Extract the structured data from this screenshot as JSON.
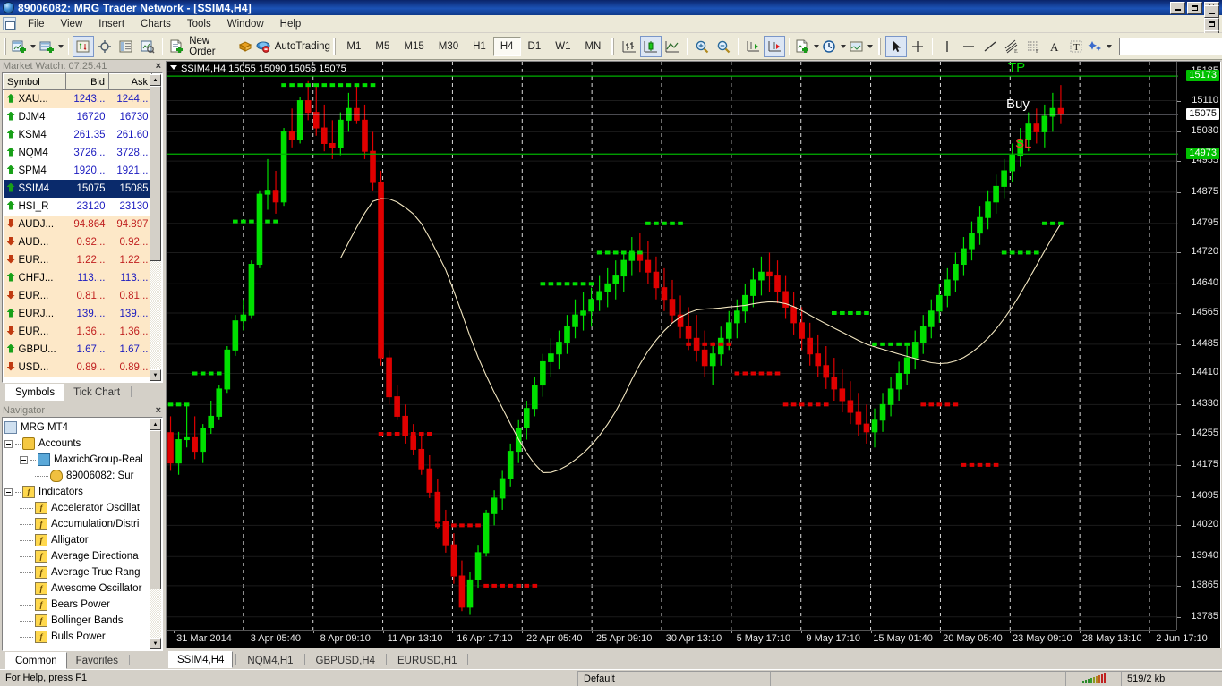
{
  "window": {
    "title": "89006082: MRG Trader Network - [SSIM4,H4]",
    "minimize": "_",
    "restore": "❐",
    "close": "×"
  },
  "menu": {
    "items": [
      "File",
      "View",
      "Insert",
      "Charts",
      "Tools",
      "Window",
      "Help"
    ]
  },
  "toolbar": {
    "new_chart_tip": "New Chart",
    "profiles_tip": "Profiles",
    "market_watch_tip": "Market Watch",
    "navigator_tip": "Navigator",
    "terminal_tip": "Terminal",
    "strategy_tester_tip": "Strategy Tester",
    "new_order": "New Order",
    "expert_advisors_tip": "Expert Advisors",
    "autotrading": "AutoTrading",
    "timeframes": [
      "M1",
      "M5",
      "M15",
      "M30",
      "H1",
      "H4",
      "D1",
      "W1",
      "MN"
    ],
    "timeframe_selected": "H4",
    "bar_chart_tip": "Bar Chart",
    "candlesticks_tip": "Candlesticks",
    "line_chart_tip": "Line Chart",
    "zoom_in_tip": "Zoom In",
    "zoom_out_tip": "Zoom Out",
    "auto_scroll_tip": "Auto Scroll",
    "chart_shift_tip": "Chart Shift",
    "indicators_tip": "Indicators",
    "period_tip": "Period",
    "templates_tip": "Templates",
    "cursor_tip": "Cursor",
    "crosshair_tip": "Crosshair",
    "vertical_line_tip": "Vertical Line",
    "horizontal_line_tip": "Horizontal Line",
    "trendline_tip": "Trendline",
    "equidistant_channel_tip": "Equidistant Channel",
    "fibonacci_tip": "Fibonacci Retracement",
    "text_tip": "Text",
    "text_label_tip": "Text Label",
    "objects_tip": "Objects",
    "search_value": ""
  },
  "market_watch": {
    "title": "Market Watch: 07:25:41",
    "close": "×",
    "columns": [
      "Symbol",
      "Bid",
      "Ask"
    ],
    "rows": [
      {
        "symbol": "XAU...",
        "bid": "1243...",
        "ask": "1244...",
        "dir": "up",
        "tint": true,
        "selected": false
      },
      {
        "symbol": "DJM4",
        "bid": "16720",
        "ask": "16730",
        "dir": "up",
        "tint": false,
        "selected": false
      },
      {
        "symbol": "KSM4",
        "bid": "261.35",
        "ask": "261.60",
        "dir": "up",
        "tint": false,
        "selected": false
      },
      {
        "symbol": "NQM4",
        "bid": "3726...",
        "ask": "3728...",
        "dir": "up",
        "tint": false,
        "selected": false
      },
      {
        "symbol": "SPM4",
        "bid": "1920...",
        "ask": "1921...",
        "dir": "up",
        "tint": false,
        "selected": false
      },
      {
        "symbol": "SSIM4",
        "bid": "15075",
        "ask": "15085",
        "dir": "up",
        "tint": false,
        "selected": true
      },
      {
        "symbol": "HSI_R",
        "bid": "23120",
        "ask": "23130",
        "dir": "up",
        "tint": false,
        "selected": false
      },
      {
        "symbol": "AUDJ...",
        "bid": "94.864",
        "ask": "94.897",
        "dir": "down",
        "tint": true,
        "selected": false
      },
      {
        "symbol": "AUD...",
        "bid": "0.92...",
        "ask": "0.92...",
        "dir": "down",
        "tint": true,
        "selected": false
      },
      {
        "symbol": "EUR...",
        "bid": "1.22...",
        "ask": "1.22...",
        "dir": "down",
        "tint": true,
        "selected": false
      },
      {
        "symbol": "CHFJ...",
        "bid": "113....",
        "ask": "113....",
        "dir": "up",
        "tint": true,
        "selected": false
      },
      {
        "symbol": "EUR...",
        "bid": "0.81...",
        "ask": "0.81...",
        "dir": "down",
        "tint": true,
        "selected": false
      },
      {
        "symbol": "EURJ...",
        "bid": "139....",
        "ask": "139....",
        "dir": "up",
        "tint": true,
        "selected": false
      },
      {
        "symbol": "EUR...",
        "bid": "1.36...",
        "ask": "1.36...",
        "dir": "down",
        "tint": true,
        "selected": false
      },
      {
        "symbol": "GBPU...",
        "bid": "1.67...",
        "ask": "1.67...",
        "dir": "up",
        "tint": true,
        "selected": false
      },
      {
        "symbol": "USD...",
        "bid": "0.89...",
        "ask": "0.89...",
        "dir": "down",
        "tint": true,
        "selected": false
      }
    ],
    "tabs": [
      "Symbols",
      "Tick Chart"
    ],
    "tab_selected": "Symbols"
  },
  "navigator": {
    "title": "Navigator",
    "close": "×",
    "items": [
      {
        "label": "MRG MT4",
        "depth": 0,
        "icon": "app",
        "expander": false
      },
      {
        "label": "Accounts",
        "depth": 0,
        "icon": "acc",
        "expander": true
      },
      {
        "label": "MaxrichGroup-Real",
        "depth": 1,
        "icon": "server",
        "expander": true
      },
      {
        "label": "89006082: Sur",
        "depth": 2,
        "icon": "user",
        "expander": false
      },
      {
        "label": "Indicators",
        "depth": 0,
        "icon": "func",
        "expander": true
      },
      {
        "label": "Accelerator Oscillat",
        "depth": 1,
        "icon": "func",
        "expander": false
      },
      {
        "label": "Accumulation/Distri",
        "depth": 1,
        "icon": "func",
        "expander": false
      },
      {
        "label": "Alligator",
        "depth": 1,
        "icon": "func",
        "expander": false
      },
      {
        "label": "Average Directiona",
        "depth": 1,
        "icon": "func",
        "expander": false
      },
      {
        "label": "Average True Rang",
        "depth": 1,
        "icon": "func",
        "expander": false
      },
      {
        "label": "Awesome Oscillator",
        "depth": 1,
        "icon": "func",
        "expander": false
      },
      {
        "label": "Bears Power",
        "depth": 1,
        "icon": "func",
        "expander": false
      },
      {
        "label": "Bollinger Bands",
        "depth": 1,
        "icon": "func",
        "expander": false
      },
      {
        "label": "Bulls Power",
        "depth": 1,
        "icon": "func",
        "expander": false
      }
    ],
    "tabs": [
      "Common",
      "Favorites"
    ],
    "tab_selected": "Common"
  },
  "chart": {
    "header": "SSIM4,H4  15055 15090 15055 15075",
    "symbol": "SSIM4",
    "period": "H4",
    "ohlc": {
      "open": "15055",
      "high": "15090",
      "low": "15055",
      "close": "15075"
    },
    "labels": {
      "tp": "TP",
      "buy": "Buy",
      "sl": "SL"
    },
    "levels": {
      "tp_price": "15173",
      "buy_price": "15075",
      "sl_price": "14973",
      "tp_color": "#00b000",
      "buy_color": "#c8c8d8",
      "sl_color": "#00b000",
      "tp_tag_bg": "#00c000",
      "sl_tag_bg": "#00c000",
      "buy_tag_bg": "#ffffff"
    },
    "colors": {
      "background": "#000000",
      "bull": "#00e000",
      "bear": "#e00000",
      "moving_average": "#f2e6c0",
      "grid": "#ffffff",
      "axis_text": "#e8e8e8"
    }
  },
  "chart_data": {
    "type": "candlestick",
    "title": "SSIM4,H4",
    "xlabel": "",
    "ylabel": "",
    "ylim": [
      13750,
      15210
    ],
    "y_ticks": [
      15185,
      15110,
      15030,
      14955,
      14875,
      14795,
      14720,
      14640,
      14565,
      14485,
      14410,
      14330,
      14255,
      14175,
      14095,
      14020,
      13940,
      13865,
      13785
    ],
    "x_ticks": [
      "31 Mar 2014",
      "3 Apr 05:40",
      "8 Apr 09:10",
      "11 Apr 13:10",
      "16 Apr 17:10",
      "22 Apr 05:40",
      "25 Apr 09:10",
      "30 Apr 13:10",
      "5 May 17:10",
      "9 May 17:10",
      "15 May 01:40",
      "20 May 05:40",
      "23 May 09:10",
      "28 May 13:10",
      "2 Jun 17:10"
    ],
    "grid": true,
    "legend": false,
    "overlays": [
      {
        "name": "Moving Average",
        "color": "#f2e6c0"
      },
      {
        "name": "Fractals Bands",
        "up_color": "#00e000",
        "down_color": "#e00000"
      }
    ],
    "hlines": [
      {
        "label": "TP",
        "value": 15173,
        "color": "#00b000"
      },
      {
        "label": "Buy",
        "value": 15075,
        "color": "#c8c8d8"
      },
      {
        "label": "SL",
        "value": 14973,
        "color": "#00b000"
      }
    ],
    "candles": [
      [
        14258,
        14300,
        14160,
        14180
      ],
      [
        14180,
        14260,
        14150,
        14240
      ],
      [
        14240,
        14330,
        14220,
        14245
      ],
      [
        14245,
        14300,
        14190,
        14210
      ],
      [
        14210,
        14280,
        14180,
        14270
      ],
      [
        14270,
        14340,
        14255,
        14300
      ],
      [
        14300,
        14380,
        14290,
        14370
      ],
      [
        14370,
        14480,
        14360,
        14470
      ],
      [
        14470,
        14560,
        14455,
        14545
      ],
      [
        14545,
        14600,
        14520,
        14560
      ],
      [
        14560,
        14700,
        14550,
        14690
      ],
      [
        14690,
        14880,
        14680,
        14870
      ],
      [
        14870,
        14960,
        14830,
        14880
      ],
      [
        14880,
        14930,
        14820,
        14850
      ],
      [
        14850,
        15040,
        14840,
        15030
      ],
      [
        15030,
        15090,
        14990,
        15010
      ],
      [
        15010,
        15120,
        15000,
        15110
      ],
      [
        15110,
        15160,
        15060,
        15080
      ],
      [
        15080,
        15150,
        15020,
        15040
      ],
      [
        15040,
        15100,
        14980,
        15000
      ],
      [
        15000,
        15060,
        14960,
        14990
      ],
      [
        14990,
        15080,
        14970,
        15060
      ],
      [
        15060,
        15130,
        15030,
        15090
      ],
      [
        15090,
        15150,
        15050,
        15060
      ],
      [
        15060,
        15100,
        14960,
        14980
      ],
      [
        14980,
        15030,
        14880,
        14900
      ],
      [
        14900,
        14930,
        14430,
        14450
      ],
      [
        14450,
        14470,
        14330,
        14350
      ],
      [
        14350,
        14380,
        14290,
        14300
      ],
      [
        14300,
        14330,
        14230,
        14250
      ],
      [
        14250,
        14280,
        14200,
        14215
      ],
      [
        14215,
        14250,
        14150,
        14165
      ],
      [
        14165,
        14200,
        14090,
        14105
      ],
      [
        14105,
        14140,
        14010,
        14030
      ],
      [
        14030,
        14060,
        13950,
        13970
      ],
      [
        13970,
        14000,
        13870,
        13890
      ],
      [
        13890,
        13930,
        13800,
        13810
      ],
      [
        13810,
        13900,
        13790,
        13880
      ],
      [
        13880,
        13970,
        13860,
        13950
      ],
      [
        13950,
        14060,
        13940,
        14050
      ],
      [
        14050,
        14110,
        14020,
        14090
      ],
      [
        14090,
        14160,
        14060,
        14140
      ],
      [
        14140,
        14230,
        14120,
        14210
      ],
      [
        14210,
        14290,
        14180,
        14270
      ],
      [
        14270,
        14340,
        14240,
        14320
      ],
      [
        14320,
        14400,
        14300,
        14380
      ],
      [
        14380,
        14460,
        14350,
        14440
      ],
      [
        14440,
        14500,
        14400,
        14460
      ],
      [
        14460,
        14520,
        14420,
        14490
      ],
      [
        14490,
        14560,
        14460,
        14530
      ],
      [
        14530,
        14600,
        14500,
        14560
      ],
      [
        14560,
        14620,
        14520,
        14570
      ],
      [
        14570,
        14630,
        14530,
        14600
      ],
      [
        14600,
        14660,
        14570,
        14620
      ],
      [
        14620,
        14680,
        14580,
        14640
      ],
      [
        14640,
        14700,
        14600,
        14660
      ],
      [
        14660,
        14720,
        14620,
        14700
      ],
      [
        14700,
        14760,
        14660,
        14720
      ],
      [
        14720,
        14770,
        14670,
        14700
      ],
      [
        14700,
        14750,
        14640,
        14670
      ],
      [
        14670,
        14710,
        14600,
        14630
      ],
      [
        14630,
        14680,
        14570,
        14600
      ],
      [
        14600,
        14650,
        14540,
        14560
      ],
      [
        14560,
        14610,
        14500,
        14530
      ],
      [
        14530,
        14580,
        14470,
        14500
      ],
      [
        14500,
        14560,
        14440,
        14470
      ],
      [
        14470,
        14520,
        14400,
        14430
      ],
      [
        14430,
        14490,
        14380,
        14460
      ],
      [
        14460,
        14530,
        14430,
        14500
      ],
      [
        14500,
        14570,
        14470,
        14540
      ],
      [
        14540,
        14600,
        14500,
        14570
      ],
      [
        14570,
        14640,
        14540,
        14610
      ],
      [
        14610,
        14680,
        14580,
        14650
      ],
      [
        14650,
        14710,
        14610,
        14670
      ],
      [
        14670,
        14720,
        14620,
        14660
      ],
      [
        14660,
        14700,
        14590,
        14620
      ],
      [
        14620,
        14660,
        14550,
        14580
      ],
      [
        14580,
        14620,
        14510,
        14540
      ],
      [
        14540,
        14580,
        14470,
        14500
      ],
      [
        14500,
        14540,
        14430,
        14460
      ],
      [
        14460,
        14510,
        14400,
        14430
      ],
      [
        14430,
        14480,
        14370,
        14400
      ],
      [
        14400,
        14450,
        14340,
        14370
      ],
      [
        14370,
        14420,
        14310,
        14340
      ],
      [
        14340,
        14390,
        14280,
        14310
      ],
      [
        14310,
        14360,
        14250,
        14280
      ],
      [
        14280,
        14330,
        14230,
        14260
      ],
      [
        14260,
        14320,
        14220,
        14290
      ],
      [
        14290,
        14360,
        14260,
        14330
      ],
      [
        14330,
        14400,
        14300,
        14370
      ],
      [
        14370,
        14440,
        14340,
        14410
      ],
      [
        14410,
        14480,
        14380,
        14450
      ],
      [
        14450,
        14520,
        14420,
        14490
      ],
      [
        14490,
        14560,
        14460,
        14530
      ],
      [
        14530,
        14600,
        14500,
        14570
      ],
      [
        14570,
        14640,
        14540,
        14610
      ],
      [
        14610,
        14680,
        14580,
        14650
      ],
      [
        14650,
        14720,
        14620,
        14690
      ],
      [
        14690,
        14760,
        14660,
        14730
      ],
      [
        14730,
        14800,
        14700,
        14770
      ],
      [
        14770,
        14840,
        14740,
        14810
      ],
      [
        14810,
        14880,
        14780,
        14850
      ],
      [
        14850,
        14920,
        14820,
        14890
      ],
      [
        14890,
        14960,
        14860,
        14930
      ],
      [
        14930,
        15000,
        14900,
        14970
      ],
      [
        14970,
        15040,
        14940,
        15010
      ],
      [
        15010,
        15080,
        14980,
        15050
      ],
      [
        15050,
        15090,
        15000,
        15030
      ],
      [
        15030,
        15100,
        14990,
        15070
      ],
      [
        15070,
        15130,
        15030,
        15090
      ],
      [
        15090,
        15150,
        15050,
        15075
      ]
    ]
  },
  "chart_tabs": {
    "items": [
      "SSIM4,H4",
      "NQM4,H1",
      "GBPUSD,H4",
      "EURUSD,H1"
    ],
    "selected": "SSIM4,H4"
  },
  "status_bar": {
    "help": "For Help, press F1",
    "profile": "Default",
    "traffic": "519/2 kb"
  }
}
